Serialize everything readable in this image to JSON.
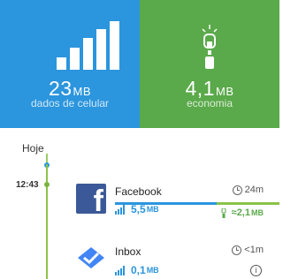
{
  "summary": {
    "data": {
      "value": "23",
      "unit": "MB",
      "caption": "dados de celular",
      "color": "#2b95dd",
      "icon": "signal-bars-icon"
    },
    "savings": {
      "value": "4,1",
      "unit": "MB",
      "caption": "economia",
      "color": "#5aa94a",
      "icon": "savings-indicator-icon"
    }
  },
  "timeline": {
    "day": "Hoje",
    "time": "12:43"
  },
  "apps": [
    {
      "name": "Facebook",
      "usage_value": "5,5",
      "usage_unit": "MB",
      "time": "24m",
      "saved_value": "≈2,1",
      "saved_unit": "MB",
      "icon": "facebook-icon",
      "data_fraction": 0.62
    },
    {
      "name": "Inbox",
      "usage_value": "0,1",
      "usage_unit": "MB",
      "time": "<1m",
      "icon": "inbox-icon",
      "info_icon": "info-icon"
    }
  ]
}
